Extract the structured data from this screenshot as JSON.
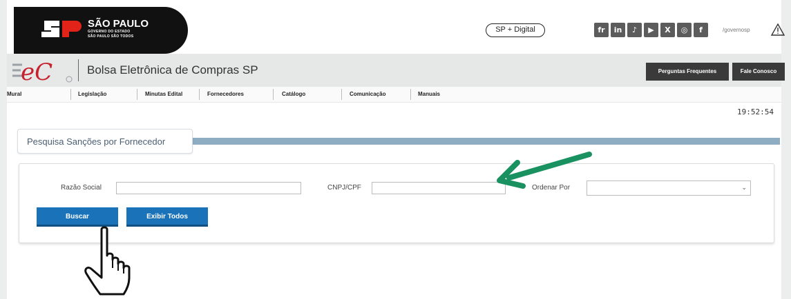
{
  "gov": {
    "title": "SÃO PAULO",
    "sub1": "GOVERNO DO ESTADO",
    "sub2": "SÃO PAULO SÃO TODOS",
    "sp_digital": "SP + Digital",
    "social": [
      "fr",
      "in",
      "♪",
      "▶",
      "X",
      "◎",
      "f"
    ],
    "handle": "/governosp"
  },
  "bec": {
    "logo_text": "eC",
    "title": "Bolsa Eletrônica de Compras SP",
    "btn_faq": "Perguntas Frequentes",
    "btn_contact": "Fale Conosco"
  },
  "menu": [
    "Mural",
    "Legislação",
    "Minutas Edital",
    "Fornecedores",
    "Catálogo",
    "Comunicação",
    "Manuais"
  ],
  "clock": "19:52:54",
  "section": {
    "title": "Pesquisa Sanções por Fornecedor"
  },
  "form": {
    "razao_label": "Razão Social",
    "razao_value": "",
    "cnpj_label": "CNPJ/CPF",
    "cnpj_value": "",
    "ordenar_label": "Ordenar Por",
    "ordenar_value": "",
    "btn_buscar": "Buscar",
    "btn_exibir": "Exibir Todos"
  },
  "colors": {
    "accent_button": "#1a73b8",
    "section_bar": "#8eadc2",
    "annotation_arrow": "#1a9160",
    "header_dark": "#111111"
  },
  "icons": {
    "warning": "warning-icon",
    "select": "chevron-down-icon",
    "arrow": "green-arrow-icon",
    "cursor": "hand-pointer-icon"
  }
}
